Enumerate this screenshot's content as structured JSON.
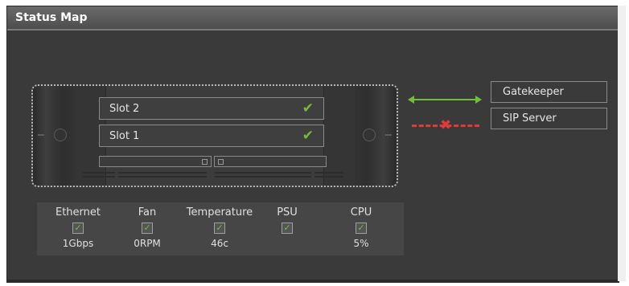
{
  "panel": {
    "title": "Status Map"
  },
  "server": {
    "slots": [
      {
        "label": "Slot 2",
        "status": "ok"
      },
      {
        "label": "Slot 1",
        "status": "ok"
      }
    ]
  },
  "connections": [
    {
      "name": "Gatekeeper",
      "state": "connected",
      "color": "#6fbf3a"
    },
    {
      "name": "SIP Server",
      "state": "disconnected",
      "color": "#e03a3a"
    }
  ],
  "status": [
    {
      "label": "Ethernet",
      "checked": true,
      "value": "1Gbps"
    },
    {
      "label": "Fan",
      "checked": true,
      "value": "0RPM"
    },
    {
      "label": "Temperature",
      "checked": true,
      "value": "46c"
    },
    {
      "label": "PSU",
      "checked": true,
      "value": ""
    },
    {
      "label": "CPU",
      "checked": true,
      "value": "5%"
    }
  ],
  "icons": {
    "check": "checkmark-icon",
    "x": "x-icon"
  }
}
